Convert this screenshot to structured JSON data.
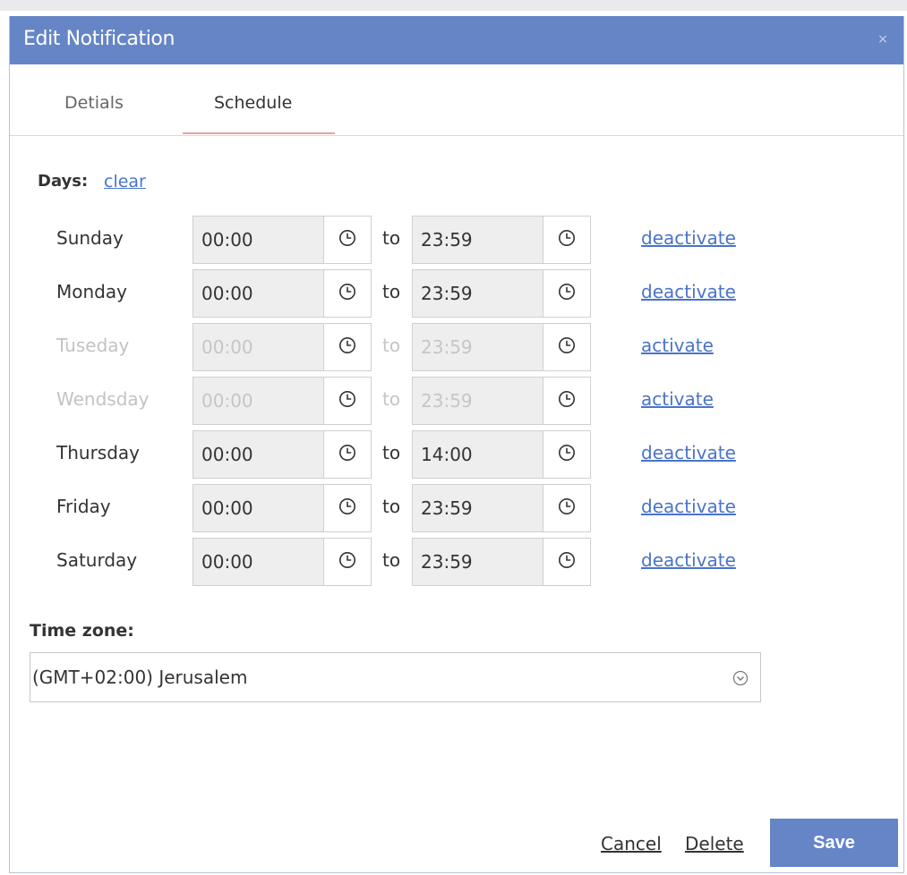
{
  "dialog": {
    "title": "Edit Notification",
    "close_icon": "close-icon"
  },
  "tabs": [
    {
      "label": "Detials"
    },
    {
      "label": "Schedule"
    }
  ],
  "schedule": {
    "days_label": "Days:",
    "clear_label": "clear",
    "to_label": "to",
    "rows": [
      {
        "day": "Sunday",
        "from": "00:00",
        "to": "23:59",
        "action": "deactivate",
        "active": true
      },
      {
        "day": "Monday",
        "from": "00:00",
        "to": "23:59",
        "action": "deactivate",
        "active": true
      },
      {
        "day": "Tuseday",
        "from": "00:00",
        "to": "23:59",
        "action": "activate",
        "active": false
      },
      {
        "day": "Wendsday",
        "from": "00:00",
        "to": "23:59",
        "action": "activate",
        "active": false
      },
      {
        "day": "Thursday",
        "from": "00:00",
        "to": "14:00",
        "action": "deactivate",
        "active": true
      },
      {
        "day": "Friday",
        "from": "00:00",
        "to": "23:59",
        "action": "deactivate",
        "active": true
      },
      {
        "day": "Saturday",
        "from": "00:00",
        "to": "23:59",
        "action": "deactivate",
        "active": true
      }
    ]
  },
  "timezone": {
    "label": "Time zone:",
    "value": "(GMT+02:00) Jerusalem",
    "chevron_icon": "chevron-down-icon"
  },
  "footer": {
    "cancel_label": "Cancel",
    "delete_label": "Delete",
    "save_label": "Save"
  },
  "colors": {
    "header": "#6585c6",
    "link": "#4a74c9",
    "tab_indicator": "#e7a1a1"
  }
}
